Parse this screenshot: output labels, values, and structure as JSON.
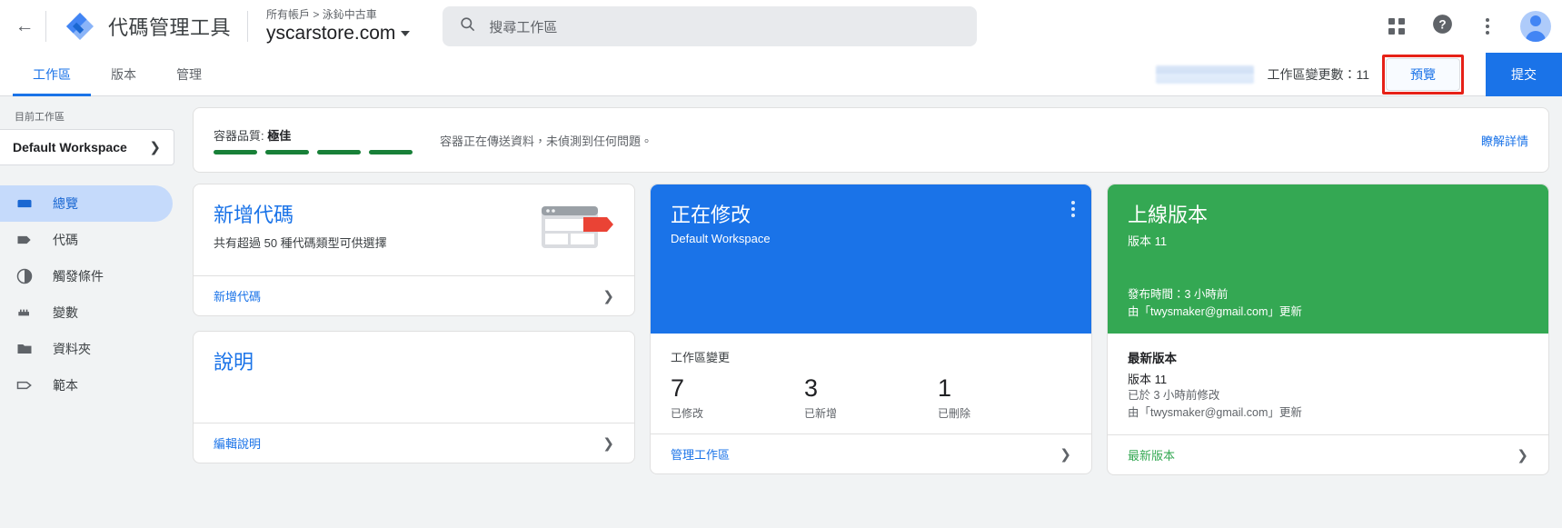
{
  "header": {
    "back_icon": "arrow-back-icon",
    "logo_icon": "gtm-logo-icon",
    "product_name": "代碼管理工具",
    "breadcrumb": "所有帳戶 > 泳鈊中古車",
    "container_name": "yscarstore.com",
    "search": {
      "icon": "search-icon",
      "placeholder": "搜尋工作區",
      "value": ""
    },
    "apps_icon": "apps-grid-icon",
    "help_icon": "help-circle-icon",
    "more_icon": "more-vert-icon",
    "avatar_icon": "account-avatar-icon"
  },
  "tabbar": {
    "tabs": [
      {
        "label": "工作區",
        "active": true
      },
      {
        "label": "版本",
        "active": false
      },
      {
        "label": "管理",
        "active": false
      }
    ],
    "redacted_label": "",
    "changes_count_label": "工作區變更數：",
    "changes_count_value": "11",
    "preview_label": "預覽",
    "submit_label": "提交",
    "highlight_color": "#e62117"
  },
  "sidebar": {
    "current_workspace_label": "目前工作區",
    "workspace_name": "Default Workspace",
    "items": [
      {
        "label": "總覽",
        "icon": "overview-icon",
        "active": true
      },
      {
        "label": "代碼",
        "icon": "tag-icon",
        "active": false
      },
      {
        "label": "觸發條件",
        "icon": "trigger-icon",
        "active": false
      },
      {
        "label": "變數",
        "icon": "variable-icon",
        "active": false
      },
      {
        "label": "資料夾",
        "icon": "folder-icon",
        "active": false
      },
      {
        "label": "範本",
        "icon": "template-icon",
        "active": false
      }
    ]
  },
  "quality_banner": {
    "title_prefix": "容器品質:",
    "title_value": "極佳",
    "bars": 4,
    "bar_color": "#188038",
    "description": "容器正在傳送資料，未偵測到任何問題。",
    "link_label": "瞭解詳情"
  },
  "new_tag_card": {
    "title": "新增代碼",
    "subtitle": "共有超過 50 種代碼類型可供選擇",
    "art_icon": "tag-illustration-icon",
    "footer_label": "新增代碼",
    "footer_chevron": "chevron-right-icon"
  },
  "help_card": {
    "title": "說明",
    "footer_label": "編輯說明",
    "footer_chevron": "chevron-right-icon"
  },
  "workspace_card": {
    "accent_color": "#1a73e8",
    "title": "正在修改",
    "subtitle": "Default Workspace",
    "menu_icon": "more-vert-icon",
    "stats_label": "工作區變更",
    "stats": [
      {
        "value": "7",
        "caption": "已修改"
      },
      {
        "value": "3",
        "caption": "已新增"
      },
      {
        "value": "1",
        "caption": "已刪除"
      }
    ],
    "footer_label": "管理工作區",
    "footer_chevron": "chevron-right-icon"
  },
  "live_version_card": {
    "accent_color": "#34a853",
    "title": "上線版本",
    "subtitle": "版本 11",
    "published_line": "發布時間：3 小時前",
    "updated_by_line": "由「twysmaker@gmail.com」更新",
    "latest_title": "最新版本",
    "latest_version": "版本 11",
    "latest_modified": "已於 3 小時前修改",
    "latest_updated_by": "由「twysmaker@gmail.com」更新",
    "footer_label": "最新版本",
    "footer_chevron": "chevron-right-icon"
  }
}
